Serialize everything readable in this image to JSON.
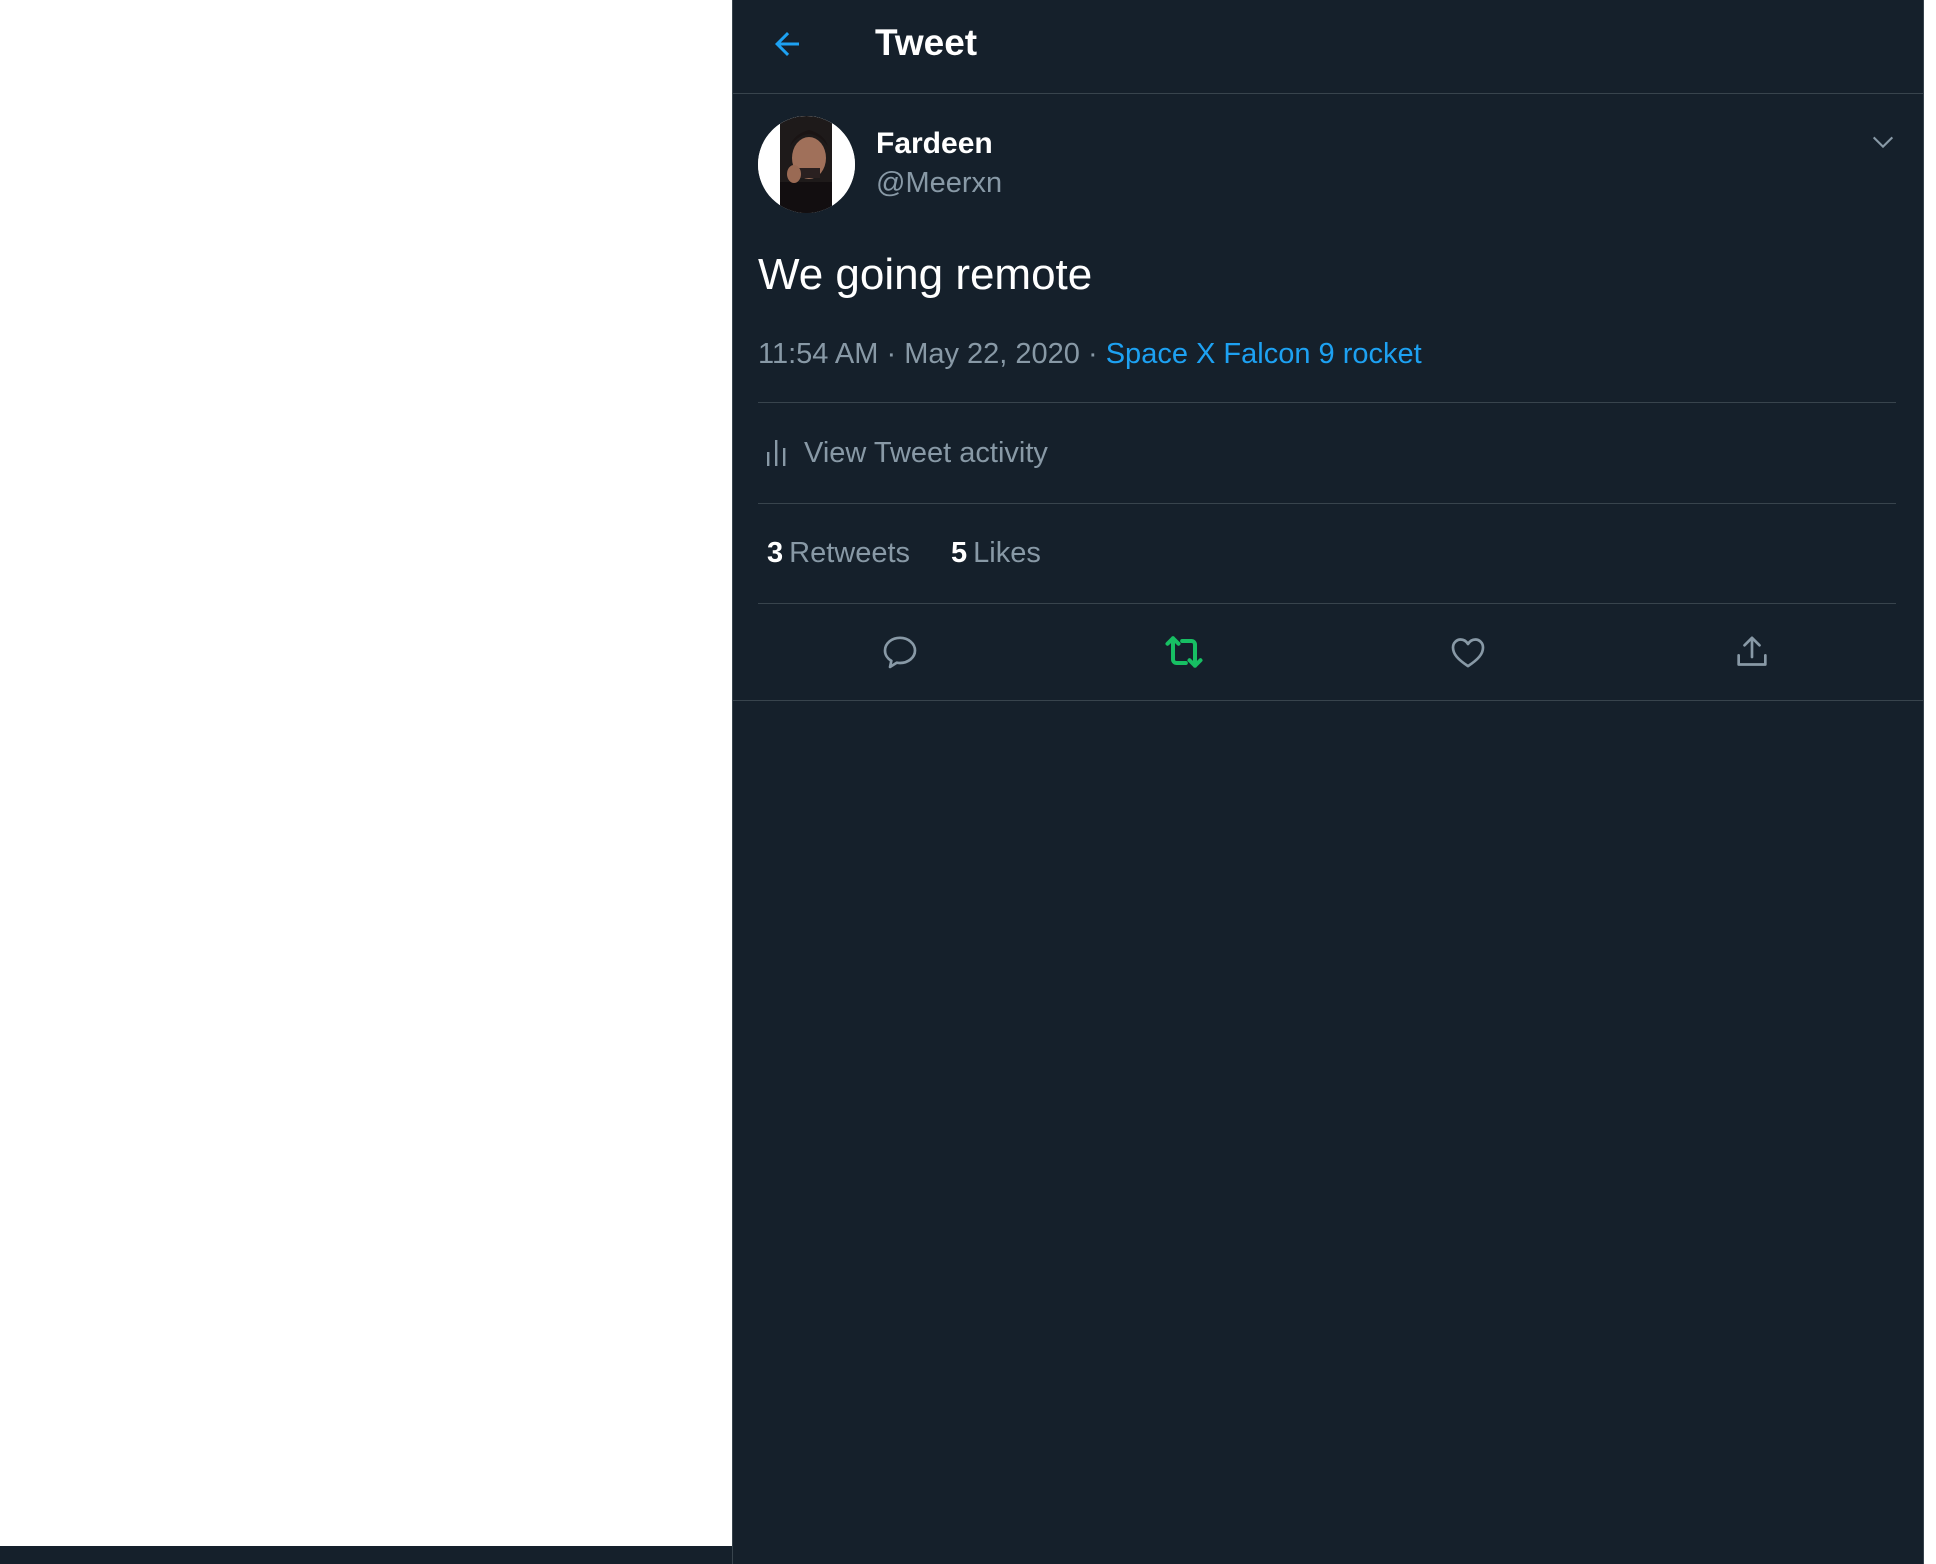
{
  "header": {
    "title": "Tweet",
    "back_icon": "arrow-left-icon"
  },
  "tweet": {
    "author": {
      "name": "Fardeen",
      "handle": "@Meerxn"
    },
    "text": "We going remote",
    "time": "11:54 AM",
    "date": "May 22, 2020",
    "separator": "·",
    "source": "Space X Falcon 9 rocket",
    "activity_label": "View Tweet activity",
    "stats": {
      "retweets_count": "3",
      "retweets_label": "Retweets",
      "likes_count": "5",
      "likes_label": "Likes"
    },
    "actions": [
      "reply-icon",
      "retweet-icon",
      "like-icon",
      "share-icon"
    ]
  },
  "colors": {
    "background": "#15202b",
    "accent": "#1da1f2",
    "retweet_active": "#17bf63",
    "secondary_text": "#8899a6",
    "border": "#38444d"
  }
}
